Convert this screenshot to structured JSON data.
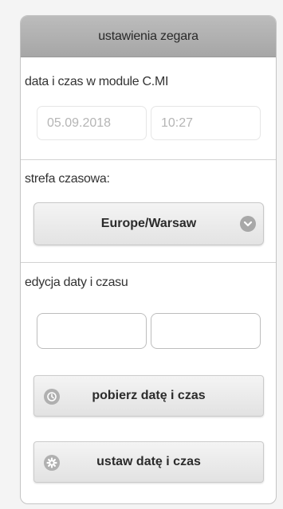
{
  "header": {
    "title": "ustawienia zegara"
  },
  "module_time": {
    "label": "data i czas w module C.MI",
    "date_value": "05.09.2018",
    "time_value": "10:27"
  },
  "timezone": {
    "label": "strefa czasowa:",
    "selected": "Europe/Warsaw"
  },
  "edit": {
    "label": "edycja daty i czasu",
    "date_value": "",
    "time_value": ""
  },
  "buttons": {
    "fetch_label": "pobierz datę i czas",
    "set_label": "ustaw datę i czas"
  }
}
